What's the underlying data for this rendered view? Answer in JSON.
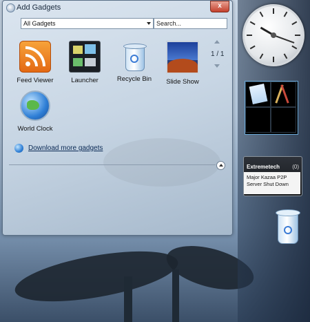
{
  "window": {
    "title": "Add Gadgets",
    "close_label": "x",
    "filter_value": "All Gadgets",
    "search_placeholder": "Search...",
    "gadgets": [
      {
        "label": "Feed Viewer",
        "icon": "rss-feed-icon"
      },
      {
        "label": "Launcher",
        "icon": "launcher-icon"
      },
      {
        "label": "Recycle Bin",
        "icon": "recycle-bin-icon"
      },
      {
        "label": "Slide Show",
        "icon": "slideshow-icon"
      },
      {
        "label": "World Clock",
        "icon": "globe-icon"
      }
    ],
    "pager": "1 / 1",
    "download_link": "Download more gadgets"
  },
  "sidebar": {
    "feed_gadget": {
      "title": "Extremetech",
      "count": "(0)",
      "headline": "Major Kazaa P2P Server Shut Down"
    }
  }
}
